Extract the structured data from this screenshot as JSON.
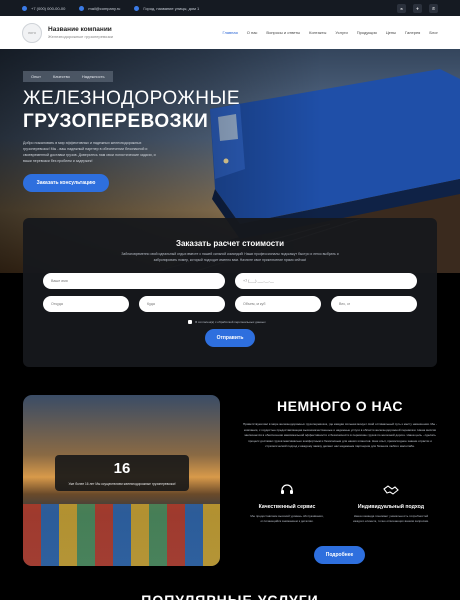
{
  "topbar": {
    "phone": "+7 (000) 000-00-00",
    "email": "mail@company.ru",
    "address": "Город, название улицы, дом 1",
    "social": [
      "vk-icon",
      "telegram-icon",
      "whatsapp-icon"
    ]
  },
  "header": {
    "logo_text": "ЛОГО",
    "company_name": "Название компании",
    "company_sub": "Железнодорожные грузоперевозки",
    "nav": [
      "Главная",
      "О нас",
      "Вопросы и ответы",
      "Контакты",
      "Услуги",
      "Продукция",
      "Цены",
      "Галерея",
      "Блог"
    ]
  },
  "hero": {
    "breadcrumbs": [
      "Опыт",
      "Качество",
      "Надежность"
    ],
    "title_line1": "ЖЕЛЕЗНОДОРОЖНЫЕ",
    "title_line2": "ГРУЗОПЕРЕВОЗКИ",
    "description": "Добро пожаловать в мир эффективных и надежных железнодорожных грузоперевозок! Мы - ваш надежный партнер в обеспечении безопасной и своевременной доставки грузов. Доверьтесь нам свои логистические задачи, и ваши перевозки без проблем и задержек!",
    "consult_button": "Заказать консультацию"
  },
  "form": {
    "title": "Заказать расчет стоимости",
    "description": "Заблаговременно свой идеальный отдых вместе с нашей сильной командой! Наши профессионалы подскажут быстро и легко выбрать и забронировать номер, который подходит именно вам. Начните свое приключение прямо сейчас!",
    "name_placeholder": "Ваше имя",
    "phone_placeholder": "+7 (___) ___-__-__",
    "from_placeholder": "Откуда",
    "to_placeholder": "Куда",
    "volume_placeholder": "Объем, м куб",
    "weight_placeholder": "Вес, кг",
    "consent": "Я согласен(а) с обработкой персональных данных",
    "submit": "Отправить"
  },
  "about": {
    "stat_number": "16",
    "stat_text": "Уже более 16 лет Мы осуществляем железнодорожные грузоперевозки!",
    "title": "НЕМНОГО О НАС",
    "text": "Приветствуем вас в мире железнодорожных грузоперевозок, где каждая сильная минует свой оптимальный путь к месту назначения. Мы - компания, с гордостью предоставляющая высококачественные и надежные услуги в области железнодорожной перевозки. Наша миссия заключается в обеспечении максимальной эффективности и безопасности в перевозке грузов по железной дороге. Наша цель - сделать процесс доставки грузов максимально комфортным и безопасным для наших клиентов. Наш опыт, превосходное знание отрасли и стратегический подход к каждому заказу делают нас надежным партнером для бизнеса любого масштаба.",
    "features": [
      {
        "icon": "headset-icon",
        "title": "Качественный сервис",
        "text": "Мы предоставляем высокий уровень обслуживания, отличающийся вниманием к деталям."
      },
      {
        "icon": "handshake-icon",
        "title": "Индивидуальный подход",
        "text": "Наша команда понимает уникальность потребностей каждого клиента, точно отвечающих вашим запросам."
      }
    ],
    "more_button": "Подробнее"
  },
  "next_section": {
    "title": "ПОПУЛЯРНЫЕ УСЛУГИ"
  },
  "colors": {
    "accent": "#2e6fde",
    "panel": "#16181c",
    "topbar": "#151a22"
  }
}
